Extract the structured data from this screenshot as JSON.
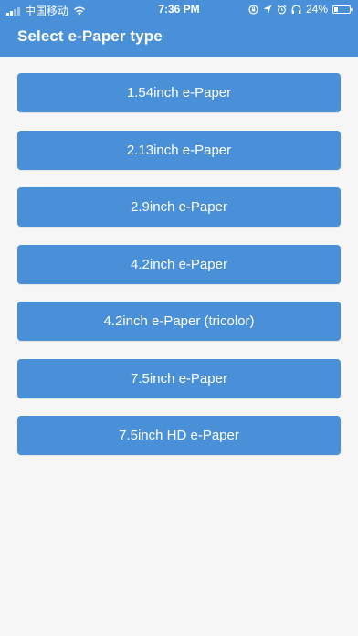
{
  "status_bar": {
    "carrier": "中国移动",
    "time": "7:36 PM",
    "battery_percent": "24%",
    "battery_level": 0.24,
    "icons": [
      "signal-icon",
      "wifi-icon",
      "rotation-lock-icon",
      "location-icon",
      "alarm-icon",
      "headphones-icon",
      "battery-icon"
    ]
  },
  "header": {
    "title": "Select e-Paper type"
  },
  "options": [
    {
      "label": "1.54inch e-Paper"
    },
    {
      "label": "2.13inch e-Paper"
    },
    {
      "label": "2.9inch e-Paper"
    },
    {
      "label": "4.2inch e-Paper"
    },
    {
      "label": "4.2inch e-Paper (tricolor)"
    },
    {
      "label": "7.5inch e-Paper"
    },
    {
      "label": "7.5inch HD e-Paper"
    }
  ],
  "colors": {
    "accent": "#4a90d8",
    "background": "#f6f6f6",
    "text_on_accent": "#ffffff"
  }
}
